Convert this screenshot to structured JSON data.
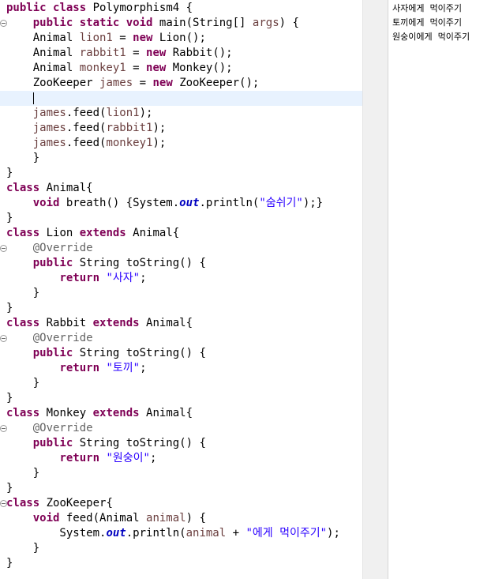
{
  "editor": {
    "lines": [
      [
        {
          "t": "public",
          "c": "kw"
        },
        {
          "t": " "
        },
        {
          "t": "class",
          "c": "kw"
        },
        {
          "t": " Polymorphism4 {"
        }
      ],
      [
        {
          "t": "    "
        },
        {
          "t": "public",
          "c": "kw"
        },
        {
          "t": " "
        },
        {
          "t": "static",
          "c": "kw"
        },
        {
          "t": " "
        },
        {
          "t": "void",
          "c": "kw"
        },
        {
          "t": " main(String[] "
        },
        {
          "t": "args",
          "c": "var"
        },
        {
          "t": ") {"
        }
      ],
      [
        {
          "t": "    Animal "
        },
        {
          "t": "lion1",
          "c": "var"
        },
        {
          "t": " = "
        },
        {
          "t": "new",
          "c": "kw"
        },
        {
          "t": " Lion();"
        }
      ],
      [
        {
          "t": "    Animal "
        },
        {
          "t": "rabbit1",
          "c": "var"
        },
        {
          "t": " = "
        },
        {
          "t": "new",
          "c": "kw"
        },
        {
          "t": " Rabbit();"
        }
      ],
      [
        {
          "t": "    Animal "
        },
        {
          "t": "monkey1",
          "c": "var"
        },
        {
          "t": " = "
        },
        {
          "t": "new",
          "c": "kw"
        },
        {
          "t": " Monkey();"
        }
      ],
      [
        {
          "t": "    ZooKeeper "
        },
        {
          "t": "james",
          "c": "var"
        },
        {
          "t": " = "
        },
        {
          "t": "new",
          "c": "kw"
        },
        {
          "t": " ZooKeeper();"
        }
      ],
      [
        {
          "t": "    "
        },
        {
          "caret": true
        }
      ],
      [
        {
          "t": "    "
        },
        {
          "t": "james",
          "c": "var"
        },
        {
          "t": ".feed("
        },
        {
          "t": "lion1",
          "c": "var"
        },
        {
          "t": ");"
        }
      ],
      [
        {
          "t": "    "
        },
        {
          "t": "james",
          "c": "var"
        },
        {
          "t": ".feed("
        },
        {
          "t": "rabbit1",
          "c": "var"
        },
        {
          "t": ");"
        }
      ],
      [
        {
          "t": "    "
        },
        {
          "t": "james",
          "c": "var"
        },
        {
          "t": ".feed("
        },
        {
          "t": "monkey1",
          "c": "var"
        },
        {
          "t": ");"
        }
      ],
      [
        {
          "t": "    }"
        }
      ],
      [
        {
          "t": "}"
        }
      ],
      [
        {
          "t": "class",
          "c": "kw"
        },
        {
          "t": " Animal{"
        }
      ],
      [
        {
          "t": "    "
        },
        {
          "t": "void",
          "c": "kw"
        },
        {
          "t": " breath() {System."
        },
        {
          "t": "out",
          "c": "fld"
        },
        {
          "t": ".println("
        },
        {
          "t": "\"숨쉬기\"",
          "c": "str"
        },
        {
          "t": ");}"
        }
      ],
      [
        {
          "t": "}"
        }
      ],
      [
        {
          "t": "class",
          "c": "kw"
        },
        {
          "t": " Lion "
        },
        {
          "t": "extends",
          "c": "kw"
        },
        {
          "t": " Animal{"
        }
      ],
      [
        {
          "t": "    "
        },
        {
          "t": "@Override",
          "c": "ann"
        }
      ],
      [
        {
          "t": "    "
        },
        {
          "t": "public",
          "c": "kw"
        },
        {
          "t": " String toString() {"
        }
      ],
      [
        {
          "t": "        "
        },
        {
          "t": "return",
          "c": "kw"
        },
        {
          "t": " "
        },
        {
          "t": "\"사자\"",
          "c": "str"
        },
        {
          "t": ";"
        }
      ],
      [
        {
          "t": "    }"
        }
      ],
      [
        {
          "t": "}"
        }
      ],
      [
        {
          "t": "class",
          "c": "kw"
        },
        {
          "t": " Rabbit "
        },
        {
          "t": "extends",
          "c": "kw"
        },
        {
          "t": " Animal{"
        }
      ],
      [
        {
          "t": "    "
        },
        {
          "t": "@Override",
          "c": "ann"
        }
      ],
      [
        {
          "t": "    "
        },
        {
          "t": "public",
          "c": "kw"
        },
        {
          "t": " String toString() {"
        }
      ],
      [
        {
          "t": "        "
        },
        {
          "t": "return",
          "c": "kw"
        },
        {
          "t": " "
        },
        {
          "t": "\"토끼\"",
          "c": "str"
        },
        {
          "t": ";"
        }
      ],
      [
        {
          "t": "    }"
        }
      ],
      [
        {
          "t": "}"
        }
      ],
      [
        {
          "t": "class",
          "c": "kw"
        },
        {
          "t": " Monkey "
        },
        {
          "t": "extends",
          "c": "kw"
        },
        {
          "t": " Animal{"
        }
      ],
      [
        {
          "t": "    "
        },
        {
          "t": "@Override",
          "c": "ann"
        }
      ],
      [
        {
          "t": "    "
        },
        {
          "t": "public",
          "c": "kw"
        },
        {
          "t": " String toString() {"
        }
      ],
      [
        {
          "t": "        "
        },
        {
          "t": "return",
          "c": "kw"
        },
        {
          "t": " "
        },
        {
          "t": "\"원숭이\"",
          "c": "str"
        },
        {
          "t": ";"
        }
      ],
      [
        {
          "t": "    }"
        }
      ],
      [
        {
          "t": "}"
        }
      ],
      [
        {
          "t": "class",
          "c": "kw"
        },
        {
          "t": " ZooKeeper{"
        }
      ],
      [
        {
          "t": "    "
        },
        {
          "t": "void",
          "c": "kw"
        },
        {
          "t": " feed(Animal "
        },
        {
          "t": "animal",
          "c": "var"
        },
        {
          "t": ") {"
        }
      ],
      [
        {
          "t": "        System."
        },
        {
          "t": "out",
          "c": "fld"
        },
        {
          "t": ".println("
        },
        {
          "t": "animal",
          "c": "var"
        },
        {
          "t": " + "
        },
        {
          "t": "\"에게 먹이주기\"",
          "c": "str"
        },
        {
          "t": ");"
        }
      ],
      [
        {
          "t": "    }"
        }
      ],
      [
        {
          "t": "}"
        }
      ]
    ],
    "current_line": 7,
    "fold_markers": [
      2,
      17,
      23,
      29,
      34
    ],
    "syntax_colors": {
      "keyword": "#7f0055",
      "local_variable": "#6a3e3e",
      "string": "#2a00ff",
      "annotation": "#646464",
      "static_field": "#0000c0",
      "current_line_highlight": "#e8f2fe"
    }
  },
  "console": {
    "lines": [
      "사자에게  먹이주기",
      "토끼에게  먹이주기",
      "원숭이에게  먹이주기"
    ]
  }
}
